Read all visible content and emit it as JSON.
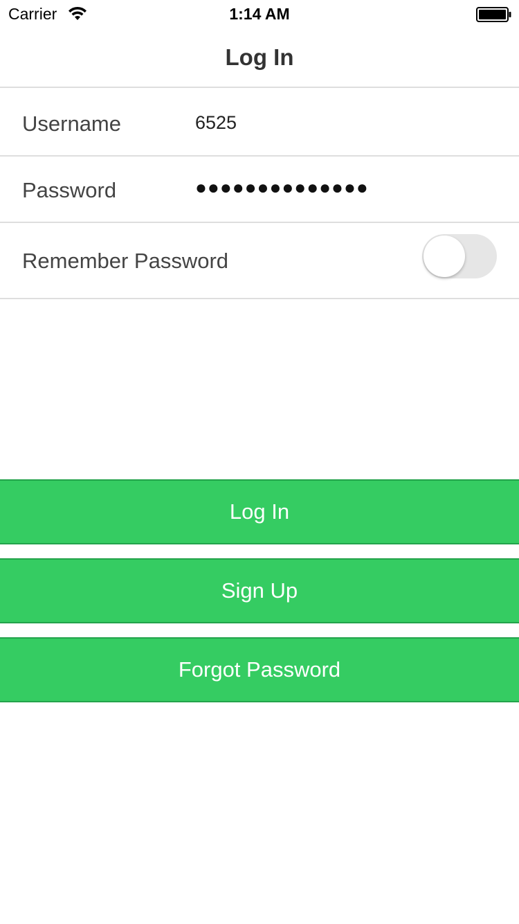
{
  "status_bar": {
    "carrier": "Carrier",
    "time": "1:14 AM",
    "wifi_icon": "wifi-icon",
    "battery_icon": "battery-icon"
  },
  "nav": {
    "title": "Log In"
  },
  "form": {
    "username_label": "Username",
    "username_value": "6525",
    "password_label": "Password",
    "password_value": "●●●●●●●●●●●●●●",
    "remember_label": "Remember Password",
    "remember_toggle_on": false
  },
  "buttons": {
    "login_label": "Log In",
    "signup_label": "Sign Up",
    "forgot_label": "Forgot Password"
  },
  "colors": {
    "accent_green": "#35cc62",
    "button_border": "#23a34b",
    "divider": "#dedede",
    "toggle_off": "#e6e6e6"
  }
}
